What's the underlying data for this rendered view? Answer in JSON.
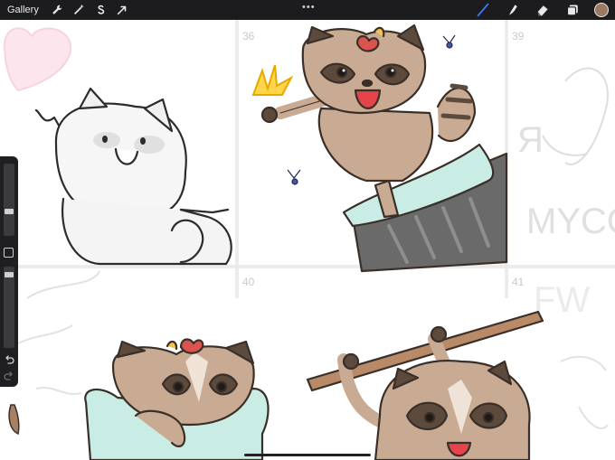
{
  "toolbar": {
    "gallery_label": "Gallery",
    "more_label": "•••",
    "left_tools": [
      "wrench-icon",
      "magic-wand-icon",
      "selection-s-icon",
      "transform-arrow-icon"
    ],
    "right_tools": [
      "brush-icon",
      "smudge-icon",
      "eraser-icon",
      "layers-icon"
    ],
    "active_tool": "brush-icon",
    "active_tool_color": "#3b7bff",
    "current_color": "#9b7a61"
  },
  "sidebar": {
    "brush_size_level": 0.5,
    "brush_opacity_level": 0.6
  },
  "canvas": {
    "panels": [
      {
        "number": "",
        "name": "panel-1"
      },
      {
        "number": "36",
        "name": "panel-2"
      },
      {
        "number": "39",
        "name": "panel-3"
      },
      {
        "number": "40",
        "name": "panel-4"
      },
      {
        "number": "41",
        "name": "panel-5"
      },
      {
        "number": "",
        "name": "panel-6"
      }
    ],
    "sketch_text_1": "Я",
    "sketch_text_2": "MYCO",
    "sketch_text_3": "FW"
  },
  "colors": {
    "raccoon_tan": "#c9ab93",
    "raccoon_dark": "#5c4a3d",
    "raccoon_cream": "#efe2d6",
    "mouth_red": "#e4444a",
    "trashcan": "#5e5e5e",
    "bag_mint": "#c9ece4",
    "stick": "#b98a68"
  }
}
